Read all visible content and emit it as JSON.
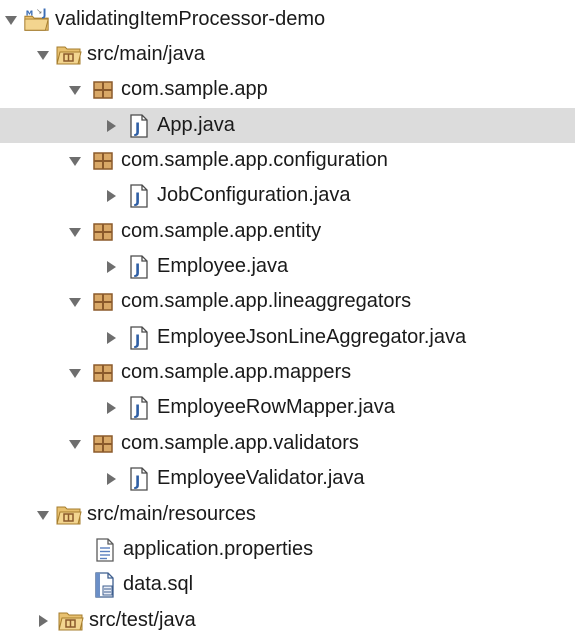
{
  "tree": {
    "project": {
      "label": "validatingItemProcessor-demo",
      "icon": "java-project-icon",
      "expanded": true
    },
    "src_main_java": {
      "label": "src/main/java",
      "icon": "source-folder-icon",
      "expanded": true
    },
    "packages": [
      {
        "label": "com.sample.app",
        "icon": "package-icon",
        "file": {
          "label": "App.java",
          "icon": "java-file-icon",
          "selected": true
        }
      },
      {
        "label": "com.sample.app.configuration",
        "icon": "package-icon",
        "file": {
          "label": "JobConfiguration.java",
          "icon": "java-file-icon",
          "selected": false
        }
      },
      {
        "label": "com.sample.app.entity",
        "icon": "package-icon",
        "file": {
          "label": "Employee.java",
          "icon": "java-file-icon",
          "selected": false
        }
      },
      {
        "label": "com.sample.app.lineaggregators",
        "icon": "package-icon",
        "file": {
          "label": "EmployeeJsonLineAggregator.java",
          "icon": "java-file-icon",
          "selected": false
        }
      },
      {
        "label": "com.sample.app.mappers",
        "icon": "package-icon",
        "file": {
          "label": "EmployeeRowMapper.java",
          "icon": "java-file-icon",
          "selected": false
        }
      },
      {
        "label": "com.sample.app.validators",
        "icon": "package-icon",
        "file": {
          "label": "EmployeeValidator.java",
          "icon": "java-file-icon",
          "selected": false
        }
      }
    ],
    "src_main_resources": {
      "label": "src/main/resources",
      "icon": "source-folder-icon",
      "expanded": true,
      "files": [
        {
          "label": "application.properties",
          "icon": "properties-file-icon"
        },
        {
          "label": "data.sql",
          "icon": "sql-file-icon"
        }
      ]
    },
    "src_test_java": {
      "label": "src/test/java",
      "icon": "source-folder-icon",
      "expanded": false
    }
  },
  "colors": {
    "selection": "#dcdcdc",
    "text": "#1a1a1a",
    "twisty": "#6e6e6e",
    "package": "#8b5a2b",
    "java_j": "#2f5fa5",
    "folder": "#e8c170"
  }
}
